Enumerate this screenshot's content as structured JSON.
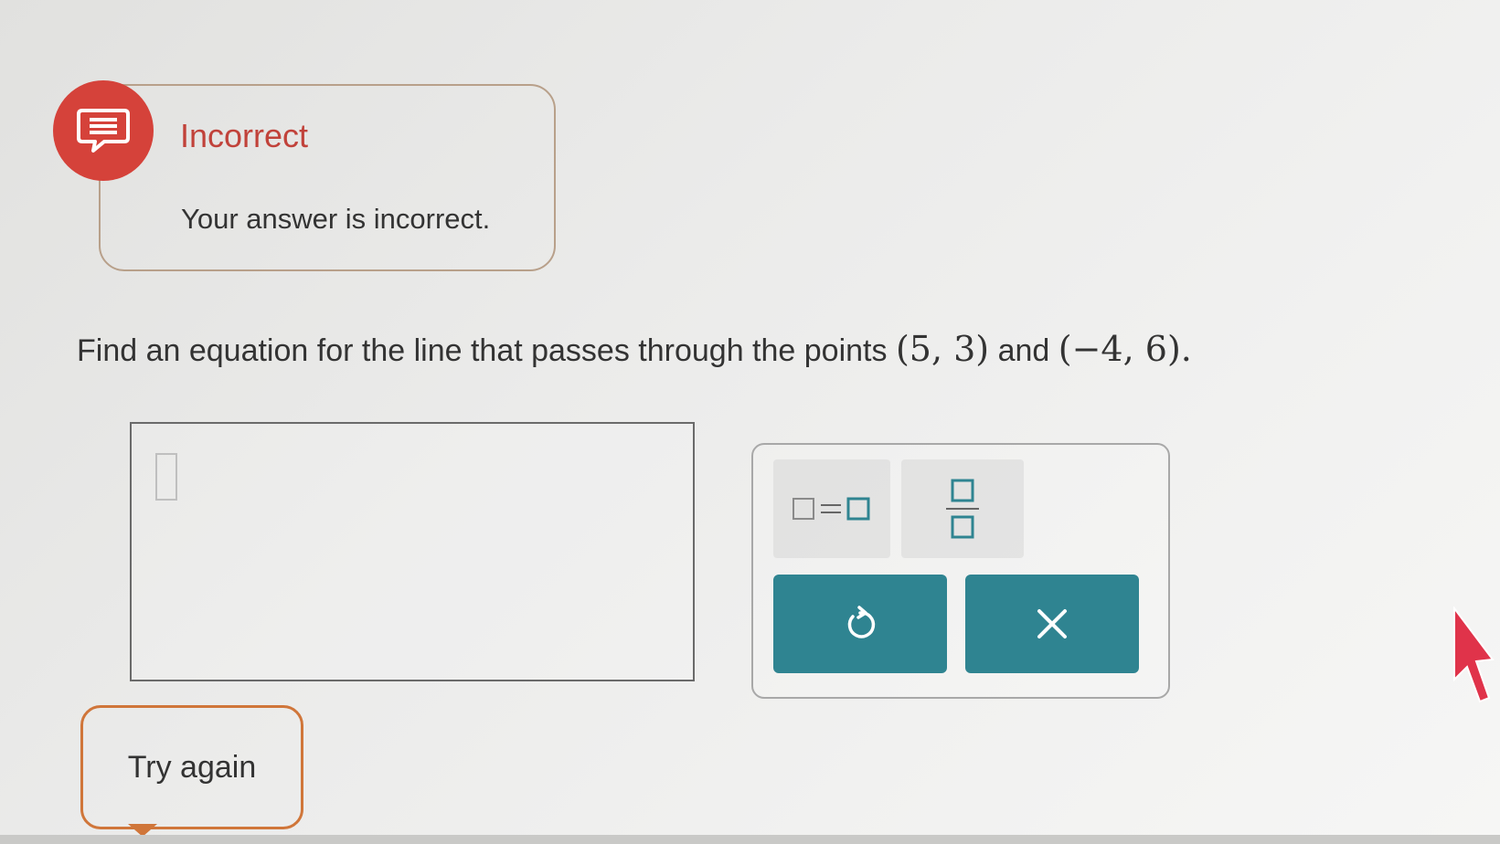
{
  "feedback": {
    "status": "Incorrect",
    "message": "Your answer is incorrect.",
    "icon": "chat-bubble-icon",
    "accent_color": "#d5423a"
  },
  "question": {
    "prefix": "Find an equation for the line that passes through the points",
    "point1": "(5, 3)",
    "connector": "and",
    "point2": "(−4, 6)",
    "suffix": "."
  },
  "answer": {
    "value": ""
  },
  "palette": {
    "tools": [
      {
        "name": "equation-template",
        "icon": "box-equals-box-icon"
      },
      {
        "name": "fraction-template",
        "icon": "fraction-icon"
      }
    ],
    "undo_icon": "undo-icon",
    "clear_icon": "close-icon",
    "button_color": "#2f8491"
  },
  "actions": {
    "try_again_label": "Try again"
  }
}
